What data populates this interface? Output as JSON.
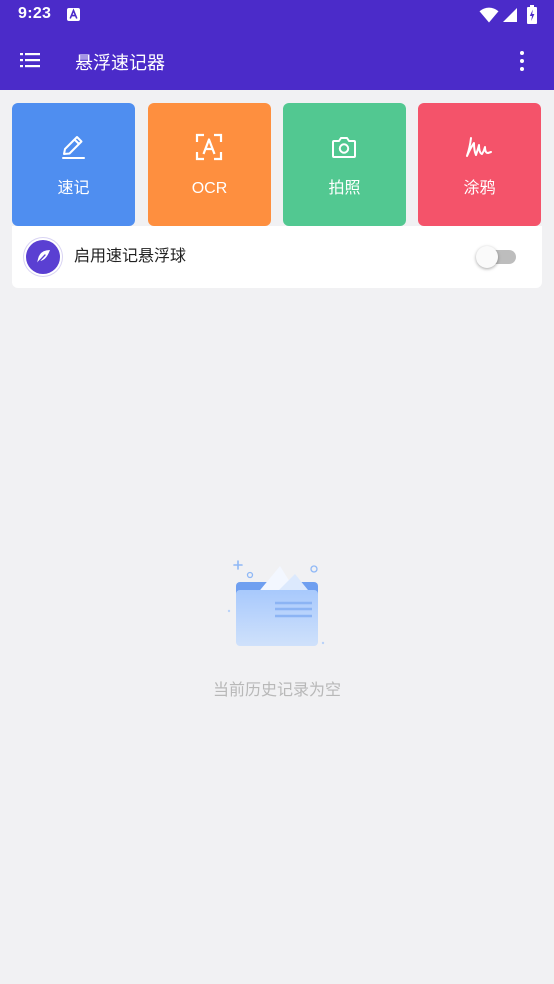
{
  "status_bar": {
    "time": "9:23",
    "notification_icon": "a-box-icon",
    "right_icons": [
      "wifi-icon",
      "signal-icon",
      "battery-charging-icon"
    ]
  },
  "app_bar": {
    "title": "悬浮速记器",
    "menu_icon": "menu-list-icon",
    "more_icon": "more-vert-icon"
  },
  "tiles": [
    {
      "label": "速记",
      "icon": "pencil-icon",
      "color": "#4f8ef0"
    },
    {
      "label": "OCR",
      "icon": "ocr-scan-icon",
      "color": "#fe8f3f"
    },
    {
      "label": "拍照",
      "icon": "camera-icon",
      "color": "#52c891"
    },
    {
      "label": "涂鸦",
      "icon": "signature-icon",
      "color": "#f4536a"
    }
  ],
  "floating_ball": {
    "label": "启用速记悬浮球",
    "icon": "feather-icon",
    "enabled": false
  },
  "empty_state": {
    "icon": "empty-folder-icon",
    "text": "当前历史记录为空"
  },
  "colors": {
    "primary": "#4b2bc9",
    "background": "#f1f1f3",
    "empty_text": "#b8b8b8"
  }
}
